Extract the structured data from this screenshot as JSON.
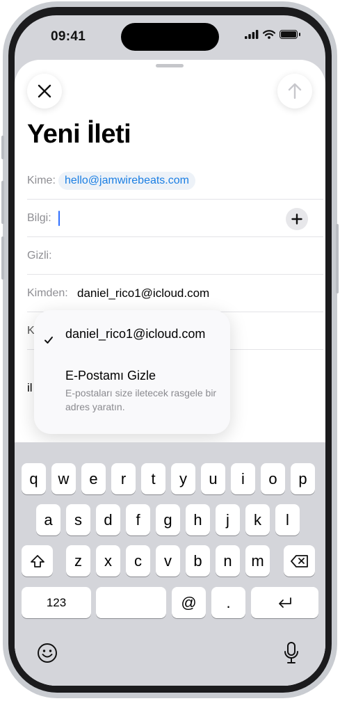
{
  "status": {
    "time": "09:41"
  },
  "compose": {
    "title": "Yeni İleti",
    "to_label": "Kime:",
    "to_value": "hello@jamwirebeats.com",
    "cc_label": "Bilgi:",
    "bcc_label": "Gizli:",
    "from_label": "Kimden:",
    "from_value": "daniel_rico1@icloud.com",
    "subject_peek": "K",
    "body_peek": "il"
  },
  "menu": {
    "item1": "daniel_rico1@icloud.com",
    "item2_title": "E-Postamı Gizle",
    "item2_subtitle": "E-postaları size iletecek rasgele bir adres yaratın."
  },
  "keyboard": {
    "row1": [
      "q",
      "w",
      "e",
      "r",
      "t",
      "y",
      "u",
      "i",
      "o",
      "p"
    ],
    "row2": [
      "a",
      "s",
      "d",
      "f",
      "g",
      "h",
      "j",
      "k",
      "l"
    ],
    "row3": [
      "z",
      "x",
      "c",
      "v",
      "b",
      "n",
      "m"
    ],
    "numbers": "123",
    "at": "@",
    "dot": "."
  },
  "colors": {
    "accent": "#1a7ee3",
    "caret": "#2f6fff",
    "keyboard_bg": "#d4d5da",
    "special_key": "#abb0ba"
  },
  "icons": [
    "close-icon",
    "send-arrow-icon",
    "plus-icon",
    "checkmark-icon",
    "shift-icon",
    "delete-icon",
    "return-icon",
    "emoji-icon",
    "microphone-icon",
    "signal-icon",
    "wifi-icon",
    "battery-icon"
  ]
}
